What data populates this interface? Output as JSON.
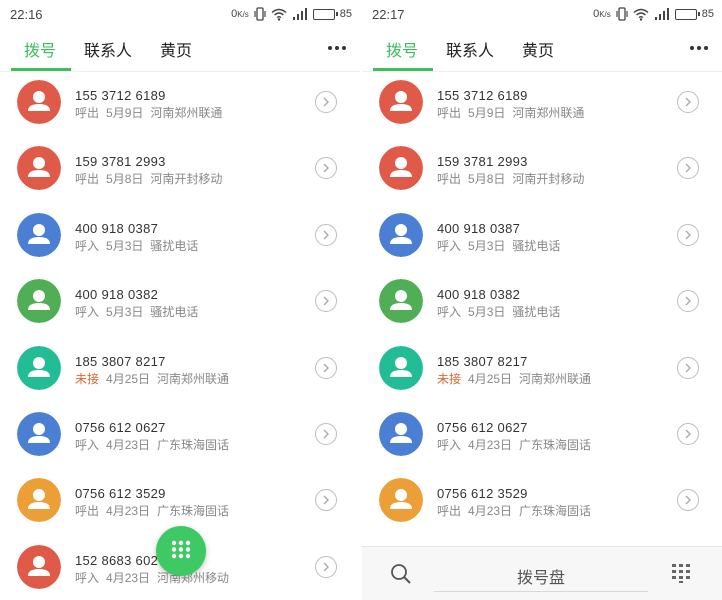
{
  "colors": {
    "accent": "#3ebd5e",
    "missed": "#e0662d",
    "red": "#e05a4a",
    "blue": "#4a7fd4",
    "green": "#4fae56",
    "teal": "#23bd95",
    "orange": "#ec9e37"
  },
  "screens": [
    {
      "status": {
        "time": "22:16",
        "data_rate": "0",
        "battery": "85"
      },
      "tabs": [
        "拨号",
        "联系人",
        "黄页"
      ],
      "active_tab": 0,
      "calls": [
        {
          "number": "155 3712 6189",
          "type": "呼出",
          "date": "5月9日",
          "location": "河南郑州联通",
          "avatar_color": "red",
          "missed": false
        },
        {
          "number": "159 3781 2993",
          "type": "呼出",
          "date": "5月8日",
          "location": "河南开封移动",
          "avatar_color": "red",
          "missed": false
        },
        {
          "number": "400 918 0387",
          "type": "呼入",
          "date": "5月3日",
          "location": "骚扰电话",
          "avatar_color": "blue",
          "missed": false
        },
        {
          "number": "400 918 0382",
          "type": "呼入",
          "date": "5月3日",
          "location": "骚扰电话",
          "avatar_color": "green",
          "missed": false
        },
        {
          "number": "185 3807 8217",
          "type": "未接",
          "date": "4月25日",
          "location": "河南郑州联通",
          "avatar_color": "teal",
          "missed": true
        },
        {
          "number": "0756 612 0627",
          "type": "呼入",
          "date": "4月23日",
          "location": "广东珠海固话",
          "avatar_color": "blue",
          "missed": false
        },
        {
          "number": "0756 612 3529",
          "type": "呼出",
          "date": "4月23日",
          "location": "广东珠海固话",
          "avatar_color": "orange",
          "missed": false
        },
        {
          "number": "152 8683 602",
          "type": "呼入",
          "date": "4月23日",
          "location": "河南郑州移动",
          "avatar_color": "red",
          "missed": false
        }
      ],
      "fab_icon": "dialpad-icon"
    },
    {
      "status": {
        "time": "22:17",
        "data_rate": "0",
        "battery": "85"
      },
      "tabs": [
        "拨号",
        "联系人",
        "黄页"
      ],
      "active_tab": 0,
      "calls": [
        {
          "number": "155 3712 6189",
          "type": "呼出",
          "date": "5月9日",
          "location": "河南郑州联通",
          "avatar_color": "red",
          "missed": false
        },
        {
          "number": "159 3781 2993",
          "type": "呼出",
          "date": "5月8日",
          "location": "河南开封移动",
          "avatar_color": "red",
          "missed": false
        },
        {
          "number": "400 918 0387",
          "type": "呼入",
          "date": "5月3日",
          "location": "骚扰电话",
          "avatar_color": "blue",
          "missed": false
        },
        {
          "number": "400 918 0382",
          "type": "呼入",
          "date": "5月3日",
          "location": "骚扰电话",
          "avatar_color": "green",
          "missed": false
        },
        {
          "number": "185 3807 8217",
          "type": "未接",
          "date": "4月25日",
          "location": "河南郑州联通",
          "avatar_color": "teal",
          "missed": true
        },
        {
          "number": "0756 612 0627",
          "type": "呼入",
          "date": "4月23日",
          "location": "广东珠海固话",
          "avatar_color": "blue",
          "missed": false
        },
        {
          "number": "0756 612 3529",
          "type": "呼出",
          "date": "4月23日",
          "location": "广东珠海固话",
          "avatar_color": "orange",
          "missed": false
        }
      ],
      "bottom_bar": {
        "label": "拨号盘",
        "search_icon": "search-icon",
        "keypad_icon": "keypad-icon"
      }
    }
  ]
}
